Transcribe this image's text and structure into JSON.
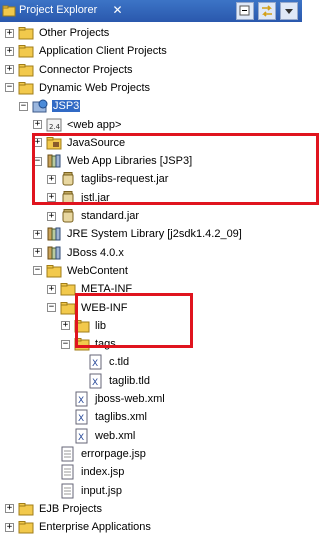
{
  "window": {
    "title": "Project Explorer"
  },
  "tree": {
    "items": [
      {
        "label": "Other Projects",
        "icon": "folder-icon",
        "expander": "+",
        "indent": 0
      },
      {
        "label": "Application Client Projects",
        "icon": "folder-icon",
        "expander": "+",
        "indent": 0
      },
      {
        "label": "Connector Projects",
        "icon": "folder-icon",
        "expander": "+",
        "indent": 0
      },
      {
        "label": "Dynamic Web Projects",
        "icon": "folder-icon",
        "expander": "-",
        "indent": 0
      },
      {
        "label": "JSP3",
        "icon": "web-project-icon",
        "expander": "-",
        "indent": 1,
        "selected": true
      },
      {
        "label": "<web app>",
        "icon": "web-app-icon",
        "expander": "+",
        "indent": 2
      },
      {
        "label": "JavaSource",
        "icon": "source-folder-icon",
        "expander": "+",
        "indent": 2
      },
      {
        "label": "Web App Libraries [JSP3]",
        "icon": "library-icon",
        "expander": "-",
        "indent": 2
      },
      {
        "label": "taglibs-request.jar",
        "icon": "jar-icon",
        "expander": "+",
        "indent": 3
      },
      {
        "label": "jstl.jar",
        "icon": "jar-icon",
        "expander": "+",
        "indent": 3
      },
      {
        "label": "standard.jar",
        "icon": "jar-icon",
        "expander": "+",
        "indent": 3
      },
      {
        "label": "JRE System Library [j2sdk1.4.2_09]",
        "icon": "library-icon",
        "expander": "+",
        "indent": 2
      },
      {
        "label": "JBoss 4.0.x",
        "icon": "library-icon",
        "expander": "+",
        "indent": 2
      },
      {
        "label": "WebContent",
        "icon": "folder-icon",
        "expander": "-",
        "indent": 2
      },
      {
        "label": "META-INF",
        "icon": "folder-icon",
        "expander": "+",
        "indent": 3
      },
      {
        "label": "WEB-INF",
        "icon": "folder-icon",
        "expander": "-",
        "indent": 3
      },
      {
        "label": "lib",
        "icon": "folder-icon",
        "expander": "+",
        "indent": 4
      },
      {
        "label": "tags",
        "icon": "folder-icon",
        "expander": "-",
        "indent": 4
      },
      {
        "label": "c.tld",
        "icon": "xml-file-icon",
        "expander": "",
        "indent": 5
      },
      {
        "label": "taglib.tld",
        "icon": "xml-file-icon",
        "expander": "",
        "indent": 5
      },
      {
        "label": "jboss-web.xml",
        "icon": "xml-file-icon",
        "expander": "",
        "indent": 4
      },
      {
        "label": "taglibs.xml",
        "icon": "xml-file-icon",
        "expander": "",
        "indent": 4
      },
      {
        "label": "web.xml",
        "icon": "xml-file-icon",
        "expander": "",
        "indent": 4
      },
      {
        "label": "errorpage.jsp",
        "icon": "jsp-file-icon",
        "expander": "",
        "indent": 3
      },
      {
        "label": "index.jsp",
        "icon": "jsp-file-icon",
        "expander": "",
        "indent": 3
      },
      {
        "label": "input.jsp",
        "icon": "jsp-file-icon",
        "expander": "",
        "indent": 3
      },
      {
        "label": "EJB Projects",
        "icon": "folder-icon",
        "expander": "+",
        "indent": 0
      },
      {
        "label": "Enterprise Applications",
        "icon": "folder-icon",
        "expander": "+",
        "indent": 0
      }
    ]
  },
  "colors": {
    "titlebar": "#2a58ad",
    "selection": "#316ac5",
    "highlight_box": "#e0141e",
    "folder": "#f2c94c"
  }
}
